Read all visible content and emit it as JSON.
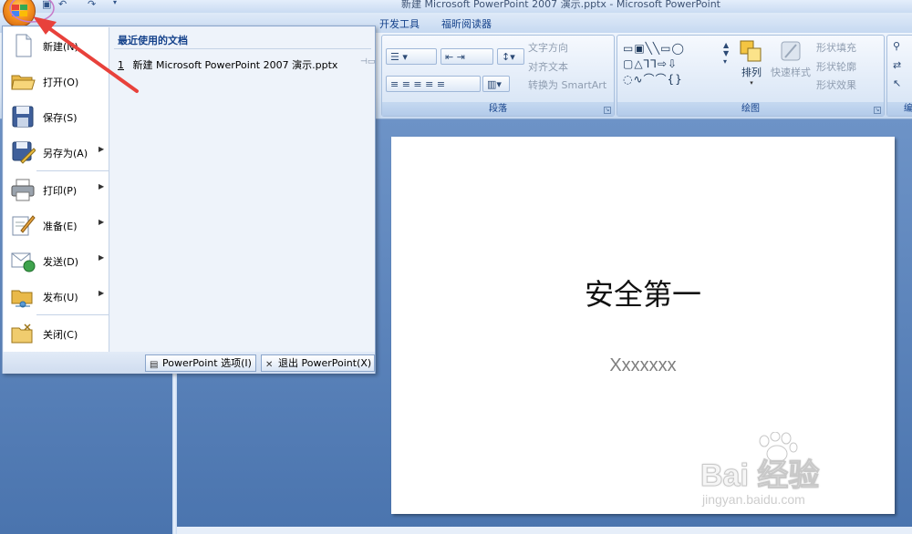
{
  "window": {
    "title": "新建 Microsoft PowerPoint 2007 演示.pptx - Microsoft PowerPoint"
  },
  "ribbon": {
    "tabs": [
      {
        "label": "开发工具"
      },
      {
        "label": "福昕阅读器"
      }
    ],
    "paragraph_group": {
      "label": "段落",
      "text_direction": "文字方向",
      "align_text": "对齐文本",
      "convert_smartart": "转换为 SmartArt"
    },
    "drawing_group": {
      "label": "绘图",
      "arrange": "排列",
      "quick_styles": "快速样式",
      "shape_fill": "形状填充",
      "shape_outline": "形状轮廓",
      "shape_effects": "形状效果"
    },
    "edit_group": {
      "label": "编"
    }
  },
  "office_menu": {
    "items": [
      {
        "label": "新建(N)",
        "icon": "new-document-icon",
        "submenu": false
      },
      {
        "label": "打开(O)",
        "icon": "open-folder-icon",
        "submenu": false
      },
      {
        "label": "保存(S)",
        "icon": "save-disk-icon",
        "submenu": false
      },
      {
        "label": "另存为(A)",
        "icon": "save-as-icon",
        "submenu": true
      },
      {
        "label": "打印(P)",
        "icon": "printer-icon",
        "submenu": true
      },
      {
        "label": "准备(E)",
        "icon": "prepare-pen-icon",
        "submenu": true
      },
      {
        "label": "发送(D)",
        "icon": "send-icon",
        "submenu": true
      },
      {
        "label": "发布(U)",
        "icon": "publish-icon",
        "submenu": true
      },
      {
        "label": "关闭(C)",
        "icon": "close-folder-icon",
        "submenu": false
      }
    ],
    "recent": {
      "heading": "最近使用的文档",
      "items": [
        {
          "index": "1",
          "name": "新建 Microsoft PowerPoint 2007 演示.pptx"
        }
      ]
    },
    "footer": {
      "options_label": "PowerPoint 选项(I)",
      "exit_label": "退出 PowerPoint(X)"
    }
  },
  "slide": {
    "title": "安全第一",
    "subtitle": "Xxxxxxx"
  },
  "watermark": {
    "brand": "Bai 经验",
    "url": "jingyan.baidu.com"
  },
  "colors": {
    "annotation_arrow": "#e8413b",
    "annotation_circle": "#c77ac9",
    "ribbon_text": "#15428b",
    "workspace": "#5d86bd"
  }
}
